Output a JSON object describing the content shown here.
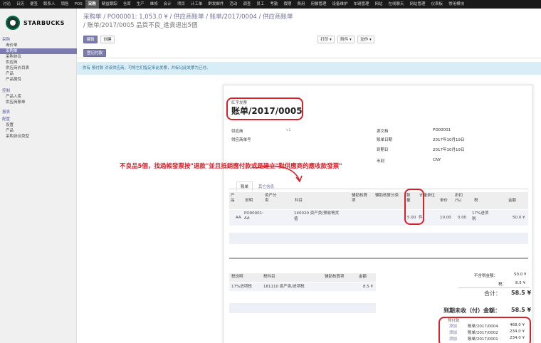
{
  "topnav": [
    "讨论",
    "日历",
    "便签",
    "联系人",
    "销售",
    "POS",
    "采购",
    "精益跟踪",
    "仓库",
    "生产",
    "维修",
    "会计",
    "项目",
    "计工单",
    "群发邮件",
    "活动",
    "调查",
    "员工",
    "考勤",
    "假期",
    "费用",
    "用餐管理",
    "设备维护",
    "车辆管理",
    "网站",
    "在线聊天",
    "网站管理",
    "仪表板",
    "常用模块"
  ],
  "topnav_active": "采购",
  "logo_text": "STARBUCKS",
  "sidebar": {
    "groups": [
      {
        "head": "采购",
        "items": [
          "询价单",
          "采购单",
          "采购协议",
          "供应商",
          "供应商价目表",
          "产品",
          "产品属性"
        ]
      },
      {
        "head": "控制",
        "items": [
          "产品入库",
          "供应商账单"
        ]
      },
      {
        "head": "报表",
        "items": []
      },
      {
        "head": "配置",
        "items": [
          "设置",
          "产品",
          "采购协议类型"
        ]
      }
    ],
    "active_item": "采购单"
  },
  "breadcrumb": {
    "line1": "采购单 / PO00001: 1,053.0 ¥ / 供应商账单 / 账单/2017/0004 / 供应商账单",
    "line2": "/ 账单/2017/0005 品質不良_進貨退出5個"
  },
  "buttons": {
    "edit": "编辑",
    "create": "创建",
    "print": "打印 ▾",
    "attach": "附件 ▾",
    "action": "动作 ▾",
    "register_payment": "登记付款"
  },
  "alert": "你有 預付款 对该供应商，可将它们指定来此发票，并标记此发票为已付。",
  "sheet": {
    "subtitle": "红字发票",
    "title": "账单/2017/0005",
    "left_fields": [
      {
        "label": "供应商",
        "value": "v1"
      },
      {
        "label": "供应商单号",
        "value": ""
      }
    ],
    "right_fields": [
      {
        "label": "源文档",
        "value": "PO00001"
      },
      {
        "label": "账单日期",
        "value": "2017年10月19日"
      },
      {
        "label": "到期日",
        "value": "2017年10月19日"
      },
      {
        "label": "币别",
        "value": "CNY"
      }
    ],
    "tabs": [
      "账单",
      "其它信息"
    ],
    "line_headers": [
      "产品",
      "说明",
      "资产分类",
      "科目",
      "辅助核算项",
      "辅助核算分类",
      "数量",
      "计量单位",
      "单价",
      "折扣(%)",
      "税",
      "金额"
    ],
    "line_row": {
      "product": "AA",
      "desc": "PO00001: AA",
      "account": "140020 资产类/预收寄货",
      "account2": "值",
      "qty": "5.00",
      "uom": "件",
      "price": "10.00",
      "discount": "0.00",
      "tax": "17%进项",
      "tax2": "税",
      "amount": "50.0 ¥"
    },
    "tax_headers": [
      "税说明",
      "税科目",
      "辅助核算项",
      "金额"
    ],
    "tax_row": {
      "desc": "17%进项税",
      "account": "181110 资产类/进项税",
      "amount": "8.5 ¥"
    },
    "totals": [
      {
        "label": "不含税金额：",
        "value": "50.0 ¥"
      },
      {
        "label": "税：",
        "value": "8.5 ¥"
      },
      {
        "label": "合计：",
        "value": "58.5 ¥"
      }
    ],
    "due": {
      "label": "到期未收（付）金额：",
      "value": "58.5 ¥"
    },
    "prepaid_label": "预付款",
    "prepaid": [
      {
        "act": "添加",
        "ref": "账单/2017/0004",
        "amount": "468.0 ¥"
      },
      {
        "act": "添加",
        "ref": "账单/2017/0002",
        "amount": "234.0 ¥"
      },
      {
        "act": "添加",
        "ref": "账单/2017/0001",
        "amount": "234.0 ¥"
      }
    ]
  },
  "annotation": "不良品5個，找過帳發票按\"退款\"並且抵銷應付款或是建立\"對供應商的應收款發票\"",
  "accent": "#7c7bad",
  "annotation_color": "#d9202a"
}
